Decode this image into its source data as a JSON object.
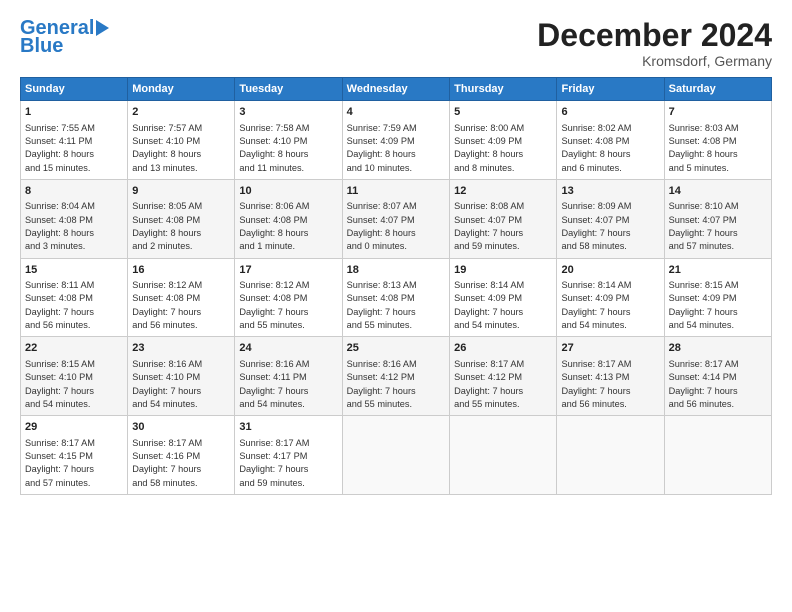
{
  "header": {
    "logo_line1": "General",
    "logo_line2": "Blue",
    "month": "December 2024",
    "location": "Kromsdorf, Germany"
  },
  "weekdays": [
    "Sunday",
    "Monday",
    "Tuesday",
    "Wednesday",
    "Thursday",
    "Friday",
    "Saturday"
  ],
  "weeks": [
    [
      {
        "day": "1",
        "info": "Sunrise: 7:55 AM\nSunset: 4:11 PM\nDaylight: 8 hours\nand 15 minutes."
      },
      {
        "day": "2",
        "info": "Sunrise: 7:57 AM\nSunset: 4:10 PM\nDaylight: 8 hours\nand 13 minutes."
      },
      {
        "day": "3",
        "info": "Sunrise: 7:58 AM\nSunset: 4:10 PM\nDaylight: 8 hours\nand 11 minutes."
      },
      {
        "day": "4",
        "info": "Sunrise: 7:59 AM\nSunset: 4:09 PM\nDaylight: 8 hours\nand 10 minutes."
      },
      {
        "day": "5",
        "info": "Sunrise: 8:00 AM\nSunset: 4:09 PM\nDaylight: 8 hours\nand 8 minutes."
      },
      {
        "day": "6",
        "info": "Sunrise: 8:02 AM\nSunset: 4:08 PM\nDaylight: 8 hours\nand 6 minutes."
      },
      {
        "day": "7",
        "info": "Sunrise: 8:03 AM\nSunset: 4:08 PM\nDaylight: 8 hours\nand 5 minutes."
      }
    ],
    [
      {
        "day": "8",
        "info": "Sunrise: 8:04 AM\nSunset: 4:08 PM\nDaylight: 8 hours\nand 3 minutes."
      },
      {
        "day": "9",
        "info": "Sunrise: 8:05 AM\nSunset: 4:08 PM\nDaylight: 8 hours\nand 2 minutes."
      },
      {
        "day": "10",
        "info": "Sunrise: 8:06 AM\nSunset: 4:08 PM\nDaylight: 8 hours\nand 1 minute."
      },
      {
        "day": "11",
        "info": "Sunrise: 8:07 AM\nSunset: 4:07 PM\nDaylight: 8 hours\nand 0 minutes."
      },
      {
        "day": "12",
        "info": "Sunrise: 8:08 AM\nSunset: 4:07 PM\nDaylight: 7 hours\nand 59 minutes."
      },
      {
        "day": "13",
        "info": "Sunrise: 8:09 AM\nSunset: 4:07 PM\nDaylight: 7 hours\nand 58 minutes."
      },
      {
        "day": "14",
        "info": "Sunrise: 8:10 AM\nSunset: 4:07 PM\nDaylight: 7 hours\nand 57 minutes."
      }
    ],
    [
      {
        "day": "15",
        "info": "Sunrise: 8:11 AM\nSunset: 4:08 PM\nDaylight: 7 hours\nand 56 minutes."
      },
      {
        "day": "16",
        "info": "Sunrise: 8:12 AM\nSunset: 4:08 PM\nDaylight: 7 hours\nand 56 minutes."
      },
      {
        "day": "17",
        "info": "Sunrise: 8:12 AM\nSunset: 4:08 PM\nDaylight: 7 hours\nand 55 minutes."
      },
      {
        "day": "18",
        "info": "Sunrise: 8:13 AM\nSunset: 4:08 PM\nDaylight: 7 hours\nand 55 minutes."
      },
      {
        "day": "19",
        "info": "Sunrise: 8:14 AM\nSunset: 4:09 PM\nDaylight: 7 hours\nand 54 minutes."
      },
      {
        "day": "20",
        "info": "Sunrise: 8:14 AM\nSunset: 4:09 PM\nDaylight: 7 hours\nand 54 minutes."
      },
      {
        "day": "21",
        "info": "Sunrise: 8:15 AM\nSunset: 4:09 PM\nDaylight: 7 hours\nand 54 minutes."
      }
    ],
    [
      {
        "day": "22",
        "info": "Sunrise: 8:15 AM\nSunset: 4:10 PM\nDaylight: 7 hours\nand 54 minutes."
      },
      {
        "day": "23",
        "info": "Sunrise: 8:16 AM\nSunset: 4:10 PM\nDaylight: 7 hours\nand 54 minutes."
      },
      {
        "day": "24",
        "info": "Sunrise: 8:16 AM\nSunset: 4:11 PM\nDaylight: 7 hours\nand 54 minutes."
      },
      {
        "day": "25",
        "info": "Sunrise: 8:16 AM\nSunset: 4:12 PM\nDaylight: 7 hours\nand 55 minutes."
      },
      {
        "day": "26",
        "info": "Sunrise: 8:17 AM\nSunset: 4:12 PM\nDaylight: 7 hours\nand 55 minutes."
      },
      {
        "day": "27",
        "info": "Sunrise: 8:17 AM\nSunset: 4:13 PM\nDaylight: 7 hours\nand 56 minutes."
      },
      {
        "day": "28",
        "info": "Sunrise: 8:17 AM\nSunset: 4:14 PM\nDaylight: 7 hours\nand 56 minutes."
      }
    ],
    [
      {
        "day": "29",
        "info": "Sunrise: 8:17 AM\nSunset: 4:15 PM\nDaylight: 7 hours\nand 57 minutes."
      },
      {
        "day": "30",
        "info": "Sunrise: 8:17 AM\nSunset: 4:16 PM\nDaylight: 7 hours\nand 58 minutes."
      },
      {
        "day": "31",
        "info": "Sunrise: 8:17 AM\nSunset: 4:17 PM\nDaylight: 7 hours\nand 59 minutes."
      },
      null,
      null,
      null,
      null
    ]
  ]
}
